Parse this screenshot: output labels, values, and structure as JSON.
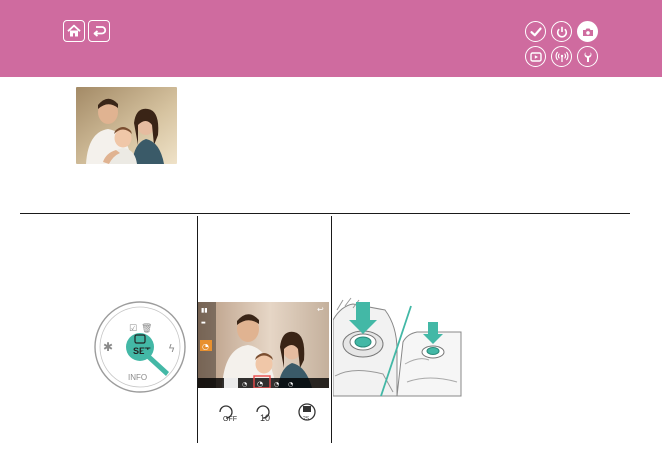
{
  "header": {
    "background": "#cf6b9f",
    "nav_buttons": [
      {
        "name": "home-button",
        "icon": "home-icon"
      },
      {
        "name": "back-button",
        "icon": "return-icon"
      }
    ],
    "section_icons": [
      {
        "name": "checklist-icon",
        "active": false
      },
      {
        "name": "power-icon",
        "active": false
      },
      {
        "name": "camera-icon",
        "active": true
      },
      {
        "name": "playback-icon",
        "active": false
      },
      {
        "name": "wireless-icon",
        "active": false
      },
      {
        "name": "settings-icon",
        "active": false
      }
    ]
  },
  "content": {
    "photo_icon": "family-photo",
    "dial_labels": {
      "func_set": "SET",
      "info": "INFO"
    },
    "screen": {
      "top_right_icon": "return-icon",
      "selected_mode_icon": "self-timer-icon"
    },
    "self_timer_options": [
      "self-timer-off-icon",
      "self-timer-10s-icon",
      "self-timer-custom-icon"
    ]
  }
}
